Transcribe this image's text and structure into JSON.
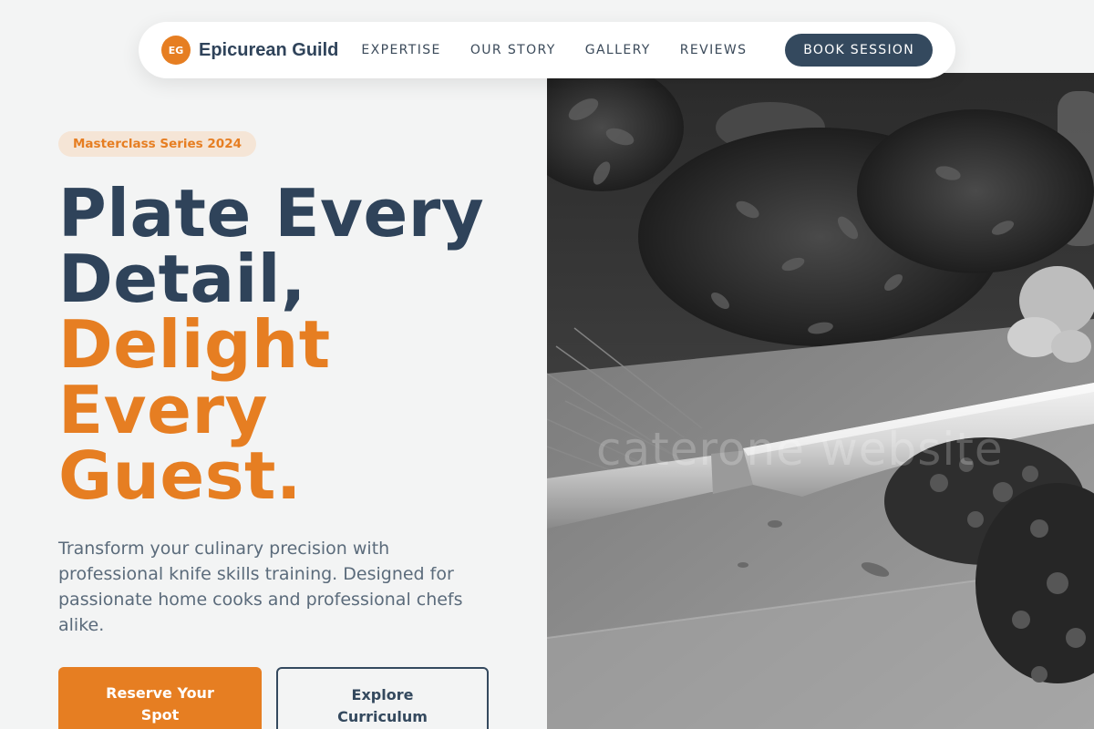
{
  "nav": {
    "logo_initials": "EG",
    "brand": "Epicurean Guild",
    "links": [
      {
        "label": "EXPERTISE"
      },
      {
        "label": "OUR STORY"
      },
      {
        "label": "GALLERY"
      },
      {
        "label": "REVIEWS"
      }
    ],
    "cta": "BOOK SESSION"
  },
  "hero": {
    "badge": "Masterclass Series 2024",
    "headline_lines": [
      "Plate Every",
      "Detail,"
    ],
    "headline_accent_lines": [
      "Delight",
      "Every",
      "Guest."
    ],
    "subtext": "Transform your culinary precision with professional knife skills training. Designed for passionate home cooks and professional chefs alike.",
    "primary_cta": "Reserve Your Spot",
    "secondary_cta": "Explore Curriculum"
  },
  "image": {
    "watermark": "caterone website"
  },
  "colors": {
    "accent": "#e67e22",
    "navy": "#34495e",
    "background": "#f3f4f4"
  }
}
